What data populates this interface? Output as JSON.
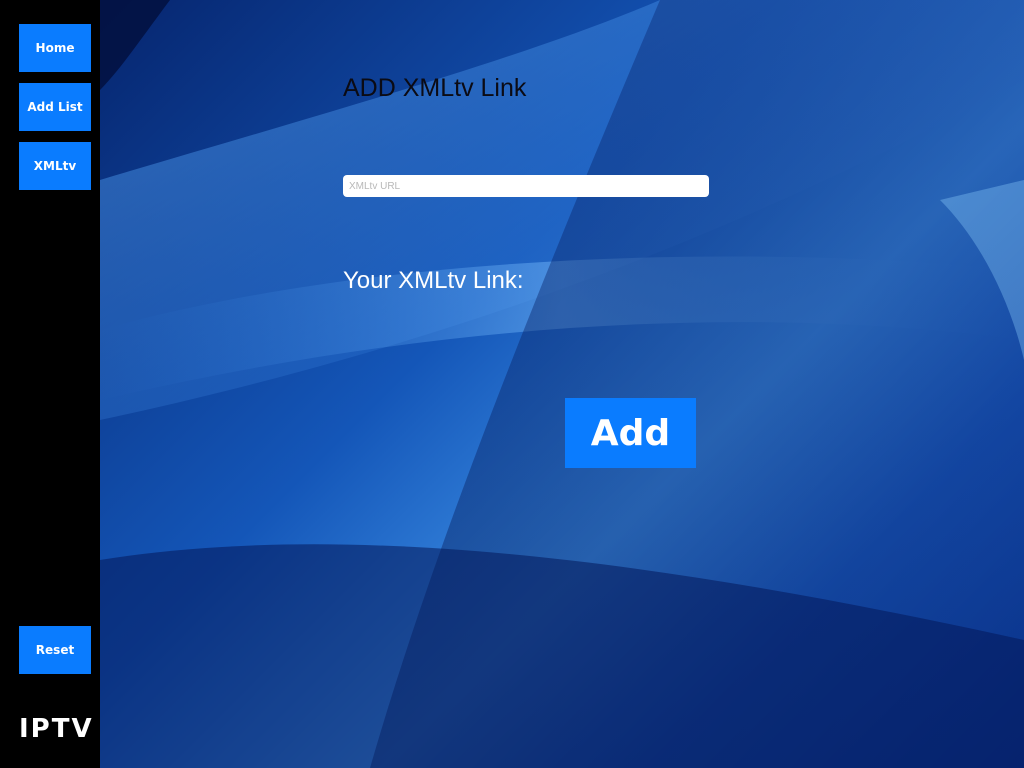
{
  "sidebar": {
    "items": [
      {
        "label": "Home"
      },
      {
        "label": "Add List"
      },
      {
        "label": "XMLtv"
      }
    ],
    "reset_label": "Reset",
    "logo_text": "IPTV"
  },
  "main": {
    "title": "ADD XMLtv Link",
    "url_input": {
      "placeholder": "XMLtv URL",
      "value": ""
    },
    "link_label": "Your XMLtv Link:",
    "add_button_label": "Add"
  },
  "colors": {
    "button_blue": "#0a7cff",
    "sidebar_bg": "#000000",
    "wallpaper_dark": "#06256e",
    "wallpaper_light": "#3d8fe6"
  }
}
